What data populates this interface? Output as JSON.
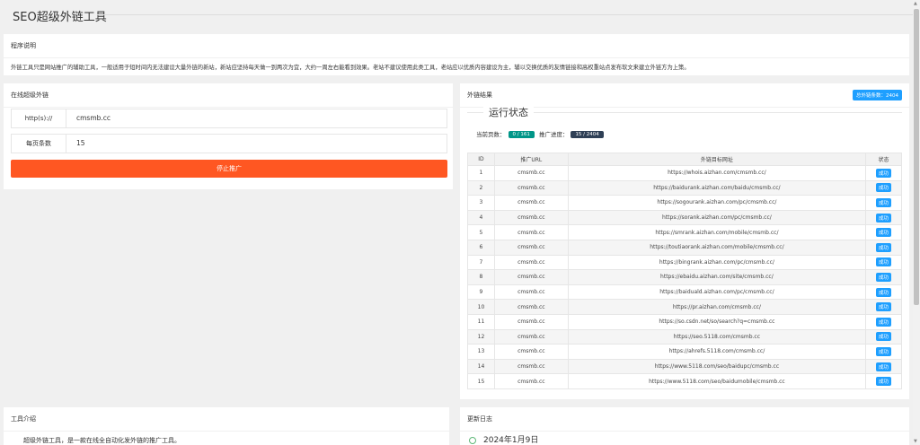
{
  "page_title": "SEO超级外链工具",
  "intro": {
    "heading": "程序说明",
    "text": "外链工具只是网站推广的辅助工具，一般适用于短时间内无法建设大量外链的新站，新站应坚持每天做一到两次为宜，大约一周左右能看到效果。老站不建议使用此类工具，老站应以优质内容建设为主，辅以交换优质的友情链接和高权重站点发布软文来建立外链方为上策。"
  },
  "online": {
    "heading": "在线超级外链",
    "url_label": "http(s)://",
    "url_value": "cmsmb.cc",
    "pages_label": "每页条数",
    "pages_value": "15",
    "stop_button": "停止推广"
  },
  "results": {
    "heading": "外链结果",
    "total_badge": "总外链条数：2404",
    "run_legend": "运行状态",
    "current_page_label": "当前页数：",
    "current_page_value": "0 / 161",
    "progress_label": "推广进度：",
    "progress_value": "15 / 2404",
    "columns": [
      "ID",
      "推广URL",
      "外链目标网址",
      "状态"
    ],
    "rows": [
      {
        "id": "1",
        "url": "cmsmb.cc",
        "target": "https://whois.aizhan.com/cmsmb.cc/",
        "status": "成功"
      },
      {
        "id": "2",
        "url": "cmsmb.cc",
        "target": "https://baidurank.aizhan.com/baidu/cmsmb.cc/",
        "status": "成功"
      },
      {
        "id": "3",
        "url": "cmsmb.cc",
        "target": "https://sogourank.aizhan.com/pc/cmsmb.cc/",
        "status": "成功"
      },
      {
        "id": "4",
        "url": "cmsmb.cc",
        "target": "https://sorank.aizhan.com/pc/cmsmb.cc/",
        "status": "成功"
      },
      {
        "id": "5",
        "url": "cmsmb.cc",
        "target": "https://smrank.aizhan.com/mobile/cmsmb.cc/",
        "status": "成功"
      },
      {
        "id": "6",
        "url": "cmsmb.cc",
        "target": "https://toutiaorank.aizhan.com/mobile/cmsmb.cc/",
        "status": "成功"
      },
      {
        "id": "7",
        "url": "cmsmb.cc",
        "target": "https://bingrank.aizhan.com/pc/cmsmb.cc/",
        "status": "成功"
      },
      {
        "id": "8",
        "url": "cmsmb.cc",
        "target": "https://ebaidu.aizhan.com/site/cmsmb.cc/",
        "status": "成功"
      },
      {
        "id": "9",
        "url": "cmsmb.cc",
        "target": "https://baiduald.aizhan.com/pc/cmsmb.cc/",
        "status": "成功"
      },
      {
        "id": "10",
        "url": "cmsmb.cc",
        "target": "https://pr.aizhan.com/cmsmb.cc/",
        "status": "成功"
      },
      {
        "id": "11",
        "url": "cmsmb.cc",
        "target": "https://so.csdn.net/so/search?q=cmsmb.cc",
        "status": "成功"
      },
      {
        "id": "12",
        "url": "cmsmb.cc",
        "target": "https://seo.5118.com/cmsmb.cc",
        "status": "成功"
      },
      {
        "id": "13",
        "url": "cmsmb.cc",
        "target": "https://ahrefs.5118.com/cmsmb.cc/",
        "status": "成功"
      },
      {
        "id": "14",
        "url": "cmsmb.cc",
        "target": "https://www.5118.com/seo/baidupc/cmsmb.cc",
        "status": "成功"
      },
      {
        "id": "15",
        "url": "cmsmb.cc",
        "target": "https://www.5118.com/seo/baidumobile/cmsmb.cc",
        "status": "成功"
      }
    ]
  },
  "tools": {
    "heading": "工具介绍",
    "line": "超级外链工具，是一款在线全自动化发外链的推广工具。"
  },
  "changelog": {
    "heading": "更新日志",
    "date": "2024年1月9日"
  },
  "colors": {
    "stop_button": "#ff5722",
    "badge_blue": "#1e9fff",
    "tag_green": "#009688",
    "tag_dark": "#2f4056"
  }
}
